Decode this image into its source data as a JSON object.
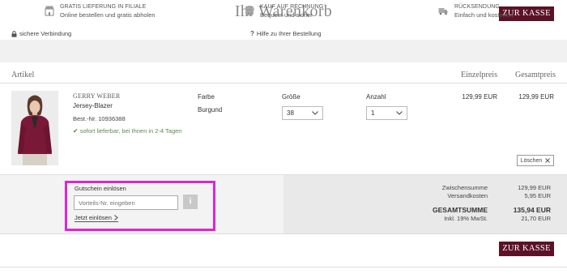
{
  "page": {
    "title": "Ihr Warenkorb",
    "checkout_label": "ZUR KASSE"
  },
  "utility": {
    "secure": "sichere Verbindung",
    "help": "Hilfe zu Ihrer Bestellung"
  },
  "benefits": [
    {
      "icon": "store-icon",
      "title": "GRATIS LIEFERUNG IN FILIALE",
      "sub": "Online bestellen und gratis abholen"
    },
    {
      "icon": "invoice-stack-icon",
      "title": "KAUF AUF RECHNUNG",
      "sub": "Bequem und sicher"
    },
    {
      "icon": "truck-icon",
      "title": "RÜCKSENDUNG",
      "sub": "Einfach und kostenlos"
    }
  ],
  "table": {
    "article": "Artikel",
    "unit_price": "Einzelpreis",
    "total_price": "Gesamtpreis"
  },
  "item": {
    "brand": "GERRY WEBER",
    "name": "Jersey-Blazer",
    "article_no": "Best.-Nr. 10936388",
    "availability": "sofort lieferbar, bei Ihnen in 2-4 Tagen",
    "color_label": "Farbe",
    "color_value": "Burgund",
    "size_label": "Größe",
    "size_value": "38",
    "qty_label": "Anzahl",
    "qty_value": "1",
    "unit_price": "129,99 EUR",
    "total_price": "129,99 EUR",
    "delete_label": "Löschen"
  },
  "voucher": {
    "title": "Gutschein einlösen",
    "placeholder": "Vorteils-Nr. eingeben",
    "info": "i",
    "redeem": "Jetzt einlösen"
  },
  "summary": {
    "subtotal_label": "Zwischensumme",
    "subtotal": "129,99 EUR",
    "shipping_label": "Versandkosten",
    "shipping": "5,95 EUR",
    "total_label": "GESAMTSUMME",
    "total": "135,94 EUR",
    "vat_label": "Inkl. 19% MwSt.",
    "vat": "21,70 EUR"
  },
  "colors": {
    "brand": "#5b1227",
    "highlight": "#e024d2",
    "stock": "#5a8c4a",
    "product": "#7a1838"
  }
}
